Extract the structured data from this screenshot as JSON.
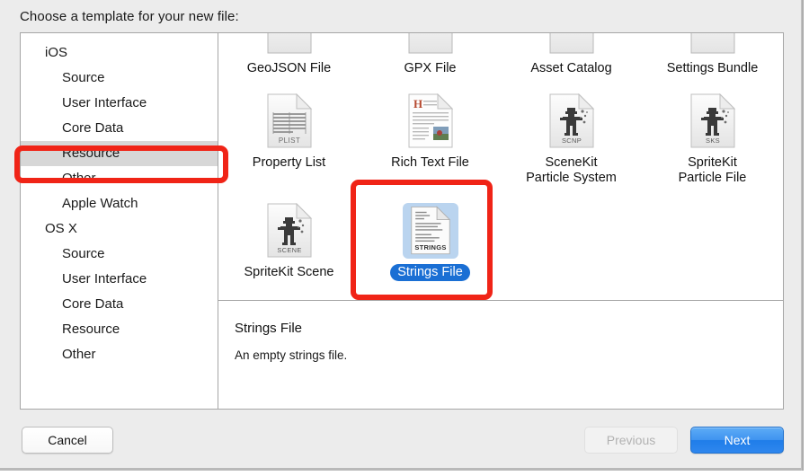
{
  "window": {
    "prompt": "Choose a template for your new file:"
  },
  "sidebar": {
    "groups": [
      {
        "header": "iOS",
        "items": [
          {
            "label": "Source",
            "selected": false
          },
          {
            "label": "User Interface",
            "selected": false
          },
          {
            "label": "Core Data",
            "selected": false
          },
          {
            "label": "Resource",
            "selected": true
          },
          {
            "label": "Other",
            "selected": false
          },
          {
            "label": "Apple Watch",
            "selected": false
          }
        ]
      },
      {
        "header": "OS X",
        "items": [
          {
            "label": "Source",
            "selected": false
          },
          {
            "label": "User Interface",
            "selected": false
          },
          {
            "label": "Core Data",
            "selected": false
          },
          {
            "label": "Resource",
            "selected": false
          },
          {
            "label": "Other",
            "selected": false
          }
        ]
      }
    ]
  },
  "templates": {
    "scrolled_off_row": [
      {
        "label": "GeoJSON File"
      },
      {
        "label": "GPX File"
      },
      {
        "label": "Asset Catalog"
      },
      {
        "label": "Settings Bundle"
      }
    ],
    "items": [
      {
        "label": "GeoJSON File",
        "icon": "geojson-file-icon",
        "selected": false
      },
      {
        "label": "GPX File",
        "icon": "gpx-file-icon",
        "selected": false
      },
      {
        "label": "Asset Catalog",
        "icon": "asset-catalog-icon",
        "selected": false
      },
      {
        "label": "Settings Bundle",
        "icon": "settings-bundle-icon",
        "selected": false
      },
      {
        "label": "Property List",
        "icon": "property-list-file-icon",
        "selected": false
      },
      {
        "label": "Rich Text File",
        "icon": "rich-text-file-icon",
        "selected": false
      },
      {
        "label": "SceneKit\nParticle System",
        "icon": "scenekit-particle-system-icon",
        "selected": false
      },
      {
        "label": "SpriteKit\nParticle File",
        "icon": "spritekit-particle-file-icon",
        "selected": false
      },
      {
        "label": "SpriteKit Scene",
        "icon": "spritekit-scene-icon",
        "selected": false
      },
      {
        "label": "Strings File",
        "icon": "strings-file-icon",
        "selected": true
      }
    ]
  },
  "description": {
    "title": "Strings File",
    "body": "An empty strings file."
  },
  "footer": {
    "cancel_label": "Cancel",
    "previous_label": "Previous",
    "next_label": "Next"
  },
  "annotations": [
    {
      "name": "resource-highlight",
      "target": "Resource"
    },
    {
      "name": "strings-file-highlight",
      "target": "Strings File"
    }
  ],
  "colors": {
    "annotation_red": "#f02417",
    "selection_blue": "#1a6fd4",
    "selection_icon_blue": "#bad4ef",
    "sidebar_selected_gray": "#d7d7d7",
    "default_button_blue": "#2f87ee",
    "window_chrome": "#ececec"
  }
}
